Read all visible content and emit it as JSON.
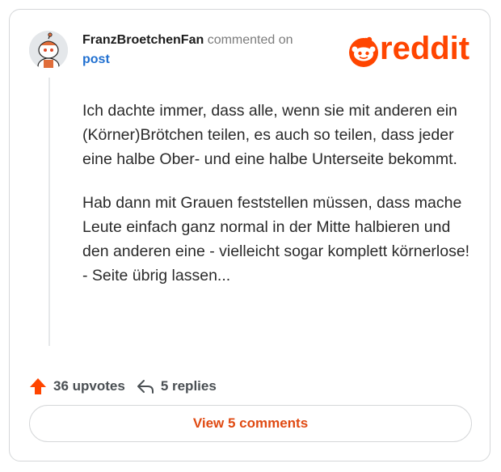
{
  "comment": {
    "username": "FranzBroetchenFan",
    "action_text": "commented on",
    "target_link": "post",
    "paragraphs": [
      "Ich dachte immer, dass alle, wenn sie mit anderen ein (Körner)Brötchen teilen, es auch so teilen, dass jeder eine halbe Ober- und eine halbe Unterseite bekommt.",
      "Hab dann mit Grauen feststellen müssen, dass mache Leute einfach ganz normal in der Mitte halbieren und den anderen eine - vielleicht sogar komplett körnerlose! - Seite übrig lassen..."
    ]
  },
  "brand": {
    "logo_text": "reddit",
    "icon": "reddit-snoo-icon",
    "color": "#ff4500"
  },
  "actions": {
    "upvotes_label": "36 upvotes",
    "replies_label": "5 replies",
    "upvote_icon": "upvote-arrow-icon",
    "reply_icon": "reply-arrow-icon"
  },
  "view_button": {
    "label": "View 5 comments",
    "color": "#e04a12"
  }
}
